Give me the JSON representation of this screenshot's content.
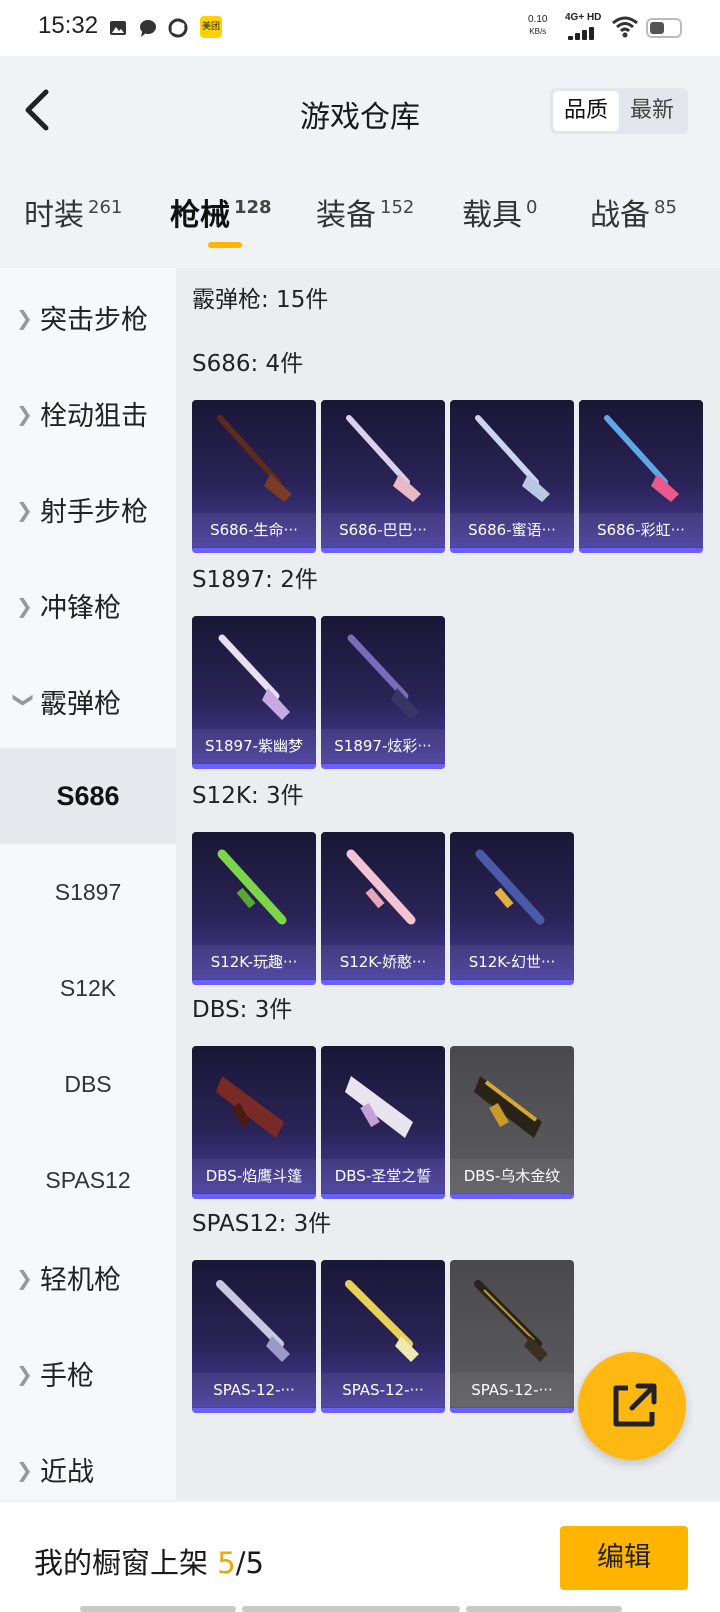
{
  "status_bar": {
    "time": "15:32",
    "meituan_label": "美团",
    "net_speed_value": "0.10",
    "net_speed_unit": "KB/s",
    "network_label": "4G+ HD",
    "icons": [
      "image-icon",
      "chat-icon",
      "sync-icon",
      "meituan-icon",
      "signal-icon",
      "wifi-icon",
      "battery-icon"
    ]
  },
  "header": {
    "title": "游戏仓库",
    "sort_options": [
      "品质",
      "最新"
    ],
    "sort_selected": "品质"
  },
  "tabs": [
    {
      "label": "时装",
      "count": "261"
    },
    {
      "label": "枪械",
      "count": "128"
    },
    {
      "label": "装备",
      "count": "152"
    },
    {
      "label": "载具",
      "count": "0"
    },
    {
      "label": "战备",
      "count": "85"
    }
  ],
  "active_tab": "枪械",
  "sidebar": {
    "categories": [
      "突击步枪",
      "栓动狙击",
      "射手步枪",
      "冲锋枪",
      "霰弹枪",
      "轻机枪",
      "手枪",
      "近战"
    ],
    "expanded_category": "霰弹枪",
    "subitems": [
      "S686",
      "S1897",
      "S12K",
      "DBS",
      "SPAS12"
    ],
    "active_subitem": "S686"
  },
  "content": {
    "summary": "霰弹枪: 15件",
    "groups": [
      {
        "heading": "S686: 4件",
        "items": [
          {
            "name": "S686-生命···",
            "quality": "purple"
          },
          {
            "name": "S686-巴巴···",
            "quality": "purple"
          },
          {
            "name": "S686-蜜语···",
            "quality": "purple"
          },
          {
            "name": "S686-彩虹···",
            "quality": "purple"
          }
        ]
      },
      {
        "heading": "S1897: 2件",
        "items": [
          {
            "name": "S1897-紫幽梦",
            "quality": "purple"
          },
          {
            "name": "S1897-炫彩···",
            "quality": "purple"
          }
        ]
      },
      {
        "heading": "S12K: 3件",
        "items": [
          {
            "name": "S12K-玩趣···",
            "quality": "purple"
          },
          {
            "name": "S12K-娇憨···",
            "quality": "purple"
          },
          {
            "name": "S12K-幻世···",
            "quality": "purple"
          }
        ]
      },
      {
        "heading": "DBS: 3件",
        "items": [
          {
            "name": "DBS-焰鹰斗篷",
            "quality": "purple"
          },
          {
            "name": "DBS-圣堂之誓",
            "quality": "purple"
          },
          {
            "name": "DBS-乌木金纹",
            "quality": "gray"
          }
        ]
      },
      {
        "heading": "SPAS12: 3件",
        "items": [
          {
            "name": "SPAS-12-···",
            "quality": "purple"
          },
          {
            "name": "SPAS-12-···",
            "quality": "purple"
          },
          {
            "name": "SPAS-12-···",
            "quality": "gray"
          }
        ]
      }
    ]
  },
  "floating_button": {
    "icon": "share-external-icon"
  },
  "bottom_bar": {
    "label": "我的橱窗上架",
    "current": "5",
    "total": "/5",
    "edit_label": "编辑"
  },
  "colors": {
    "accent": "#ffb400",
    "purple_card": "#4b40a3",
    "gray_card": "#57575c",
    "background": "#f0f2f6"
  }
}
